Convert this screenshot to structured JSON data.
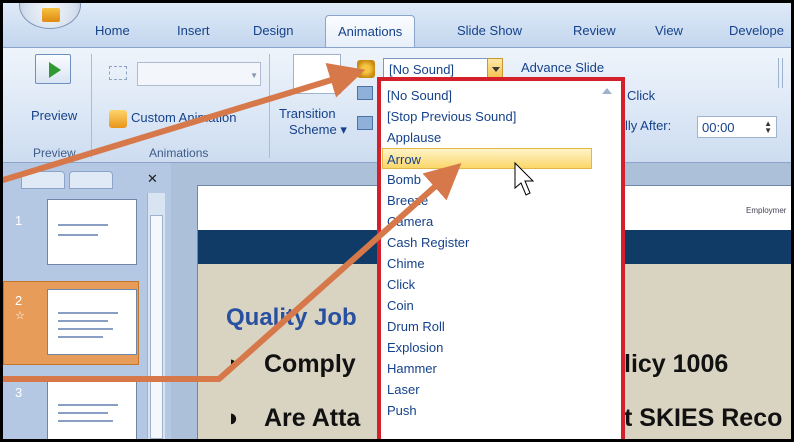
{
  "tabs": [
    "Home",
    "Insert",
    "Design",
    "Animations",
    "Slide Show",
    "Review",
    "View",
    "Develope"
  ],
  "ribbon": {
    "preview_label": "Preview",
    "preview_group": "Preview",
    "custom_animation_label": "Custom Animation",
    "animations_group": "Animations",
    "transition_scheme_line1": "Transition",
    "transition_scheme_line2": "Scheme",
    "sound_value": "[No Sound]",
    "advance_slide_label": "Advance Slide",
    "on_click_label": "Click",
    "auto_after_label": "lly After:",
    "auto_after_value": "00:00"
  },
  "slides_panel": {
    "numbers": [
      "1",
      "2",
      "3"
    ]
  },
  "slide": {
    "header_text": "Employmer",
    "title": "Quality Job",
    "bullet1_left": "Comply",
    "bullet1_right": "licy 1006",
    "bullet2_left": "Are Atta",
    "bullet2_right": "t SKIES Reco"
  },
  "sound_list": [
    "[No Sound]",
    "[Stop Previous Sound]",
    "Applause",
    "Arrow",
    "Bomb",
    "Breeze",
    "Camera",
    "Cash Register",
    "Chime",
    "Click",
    "Coin",
    "Drum Roll",
    "Explosion",
    "Hammer",
    "Laser",
    "Push"
  ],
  "sound_list_highlighted_index": 3,
  "colors": {
    "ribbon_text": "#15428b",
    "highlight_box": "#d4202a",
    "callout_arrow": "#d6784a",
    "slide_band": "#0f3b66"
  }
}
